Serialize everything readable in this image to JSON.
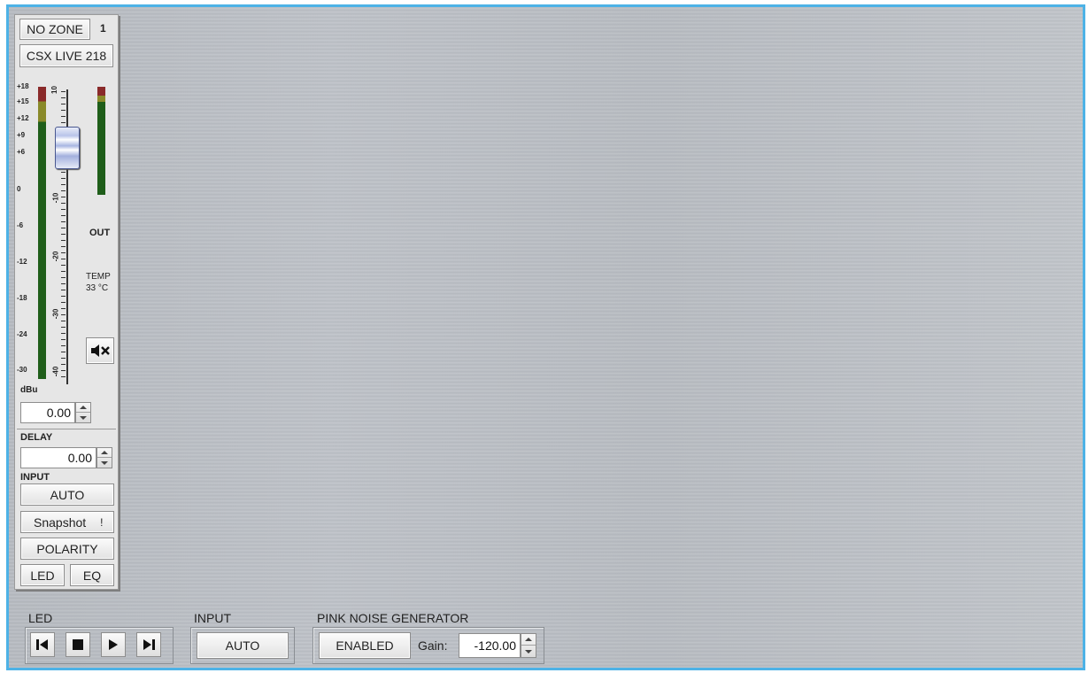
{
  "strip": {
    "zone_button": "NO ZONE",
    "channel_number": "1",
    "device_name": "CSX LIVE 218",
    "meter_scale": [
      "+18",
      "+15",
      "+12",
      "+9",
      "+6",
      "0",
      "-6",
      "-12",
      "-18",
      "-24",
      "-30"
    ],
    "meter_unit": "dBu",
    "fader_scale": [
      "10",
      "-10",
      "-20",
      "-30",
      "-40"
    ],
    "out_label": "OUT",
    "temp_label": "TEMP",
    "temp_value": "33 °C",
    "gain_value": "0.00",
    "delay_label": "DELAY",
    "delay_value": "0.00",
    "input_label": "INPUT",
    "input_button": "AUTO",
    "snapshot_button": "Snapshot",
    "snapshot_indicator": "!",
    "polarity_button": "POLARITY",
    "led_button": "LED",
    "eq_button": "EQ",
    "mute_icon": "speaker-mute-icon"
  },
  "bottom": {
    "led_label": "LED",
    "led_buttons": [
      "skip-back-icon",
      "stop-icon",
      "play-icon",
      "skip-forward-icon"
    ],
    "input_label": "INPUT",
    "input_button": "AUTO",
    "pink_label": "PINK NOISE GENERATOR",
    "pink_enabled_button": "ENABLED",
    "gain_label": "Gain:",
    "gain_value": "-120.00"
  },
  "colors": {
    "frame_border": "#4db2e6",
    "meter_green": "#1f5e1a",
    "meter_yellow": "#8a8a2a",
    "meter_red": "#8a2a2a"
  }
}
